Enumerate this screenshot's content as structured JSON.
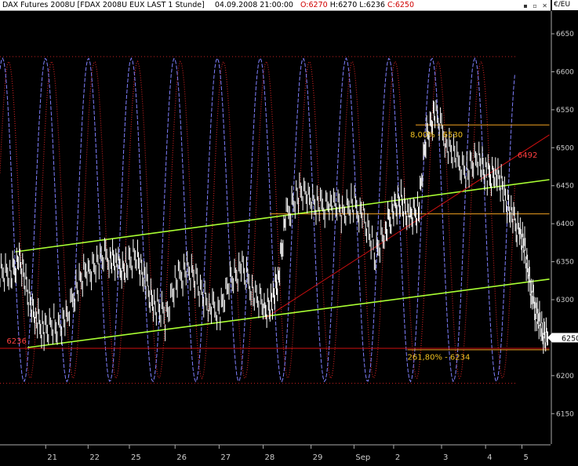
{
  "header": {
    "symbol": "DAX Futures 2008U [FDAX 2008U EUX LAST 1 Stunde]",
    "datetime": "04.09.2008 21:00:00",
    "open_label": "O:6270",
    "high_label": "H:6270",
    "low_label": "L:6236",
    "close_label": "C:6250",
    "unit": "€/EU"
  },
  "colors": {
    "background": "#000000",
    "price": "#ffffff",
    "channel": "#aaff33",
    "fib": "#f0a020",
    "trend": "#d01010",
    "osc_dotted": "#c02020",
    "osc_dashed": "#8080ff"
  },
  "chart_data": {
    "type": "line",
    "title": "DAX Futures 2008U [FDAX 2008U EUX LAST 1 Stunde]",
    "ylim": [
      6110,
      6680
    ],
    "y_ticks": [
      6150,
      6200,
      6250,
      6300,
      6350,
      6400,
      6450,
      6500,
      6550,
      6600,
      6650
    ],
    "y_tick_labels": [
      "6150",
      "6200",
      "6250",
      "6300",
      "6350",
      "6400",
      "6450",
      "6500",
      "6550",
      "6600",
      "6650"
    ],
    "x_ticks": [
      0.083,
      0.16,
      0.235,
      0.318,
      0.398,
      0.478,
      0.565,
      0.643,
      0.715,
      0.802,
      0.882,
      0.948
    ],
    "x_tick_labels": [
      "21",
      "22",
      "25",
      "26",
      "27",
      "28",
      "29",
      "Sep",
      "2",
      "3",
      "4",
      "5"
    ],
    "last_price": 6250,
    "last_price_label": "6250",
    "price_series": {
      "name": "",
      "x": [
        0.0,
        0.02,
        0.035,
        0.05,
        0.065,
        0.08,
        0.1,
        0.12,
        0.14,
        0.16,
        0.18,
        0.2,
        0.215,
        0.23,
        0.25,
        0.265,
        0.28,
        0.3,
        0.32,
        0.34,
        0.36,
        0.38,
        0.4,
        0.42,
        0.44,
        0.46,
        0.48,
        0.495,
        0.505,
        0.52,
        0.54,
        0.56,
        0.58,
        0.6,
        0.62,
        0.64,
        0.66,
        0.68,
        0.7,
        0.715,
        0.73,
        0.745,
        0.76,
        0.775,
        0.79,
        0.81,
        0.83,
        0.85,
        0.87,
        0.885,
        0.9,
        0.915,
        0.93,
        0.945
      ],
      "values": [
        6340,
        6330,
        6355,
        6310,
        6275,
        6260,
        6265,
        6270,
        6320,
        6340,
        6350,
        6360,
        6340,
        6345,
        6355,
        6320,
        6295,
        6275,
        6325,
        6340,
        6320,
        6290,
        6285,
        6330,
        6340,
        6310,
        6290,
        6295,
        6330,
        6410,
        6440,
        6435,
        6420,
        6430,
        6415,
        6425,
        6410,
        6360,
        6390,
        6420,
        6430,
        6405,
        6420,
        6520,
        6545,
        6510,
        6480,
        6470,
        6485,
        6460,
        6470,
        6440,
        6410,
        6385
      ]
    },
    "price_series_tail": {
      "x": [
        0.945,
        0.955,
        0.965,
        0.975,
        0.985,
        0.995
      ],
      "values": [
        6385,
        6360,
        6310,
        6280,
        6258,
        6250
      ]
    },
    "channel_lines": [
      {
        "x": [
          0.028,
          0.998
        ],
        "values": [
          6363,
          6458
        ]
      },
      {
        "x": [
          0.05,
          0.998
        ],
        "values": [
          6237,
          6327
        ]
      }
    ],
    "trend_line": {
      "x": [
        0.48,
        0.998
      ],
      "values": [
        6275,
        6517
      ]
    },
    "horizontal_levels": [
      {
        "value": 6530,
        "color": "#f0a020",
        "x_start": 0.755,
        "x_end": 0.998
      },
      {
        "value": 6413,
        "color": "#f0a020",
        "x_start": 0.49,
        "x_end": 0.998
      },
      {
        "value": 6236,
        "color": "#d01010",
        "x_start": 0.0,
        "x_end": 0.998
      },
      {
        "value": 6234,
        "color": "#f0a020",
        "x_start": 0.74,
        "x_end": 0.998
      }
    ],
    "oscillator_bounds": {
      "upper": 6620,
      "lower": 6190
    },
    "annotations": [
      {
        "text": "6236",
        "x": 0.012,
        "value": 6242,
        "color": "#ff4040"
      },
      {
        "text": "6492",
        "x": 0.94,
        "value": 6487,
        "color": "#ff4040"
      },
      {
        "text": "8,00% - 6530",
        "x": 0.745,
        "value": 6514,
        "color": "#f0c020"
      },
      {
        "text": "261,80% - 6234",
        "x": 0.74,
        "value": 6221,
        "color": "#f0c020"
      }
    ]
  }
}
